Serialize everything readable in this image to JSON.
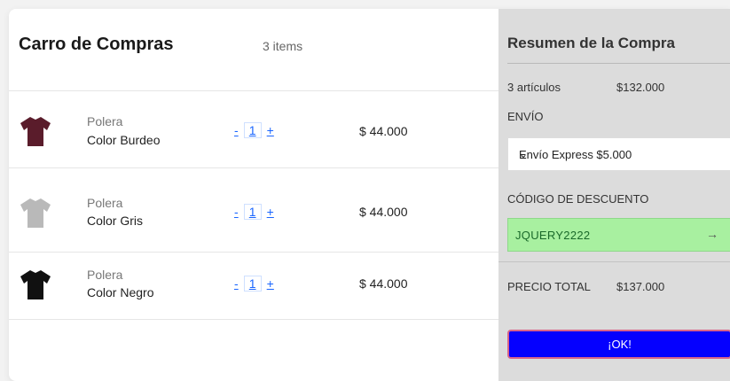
{
  "colors": {
    "ok_button": "#0500ff",
    "discount_field": "#a8f0a0",
    "quantity_link": "#1a66ff",
    "summary_bg": "#dcdcdc"
  },
  "cart": {
    "title": "Carro de Compras",
    "count": "3 items",
    "items": [
      {
        "category": "Polera",
        "name": "Color Burdeo",
        "qty": "1",
        "minus": "-",
        "plus": "+",
        "price": "$ 44.000",
        "shirt_color": "#5a1c2b",
        "icon": "tshirt-icon"
      },
      {
        "category": "Polera",
        "name": "Color Gris",
        "qty": "1",
        "minus": "-",
        "plus": "+",
        "price": "$ 44.000",
        "shirt_color": "#b9b9b9",
        "icon": "tshirt-icon"
      },
      {
        "category": "Polera",
        "name": "Color Negro",
        "qty": "1",
        "minus": "-",
        "plus": "+",
        "price": "$ 44.000",
        "shirt_color": "#111111",
        "icon": "tshirt-icon"
      }
    ]
  },
  "summary": {
    "title": "Resumen de la Compra",
    "items_label": "3 artículos",
    "items_price": "$132.000",
    "shipping_label": "ENVÍO",
    "shipping_selected": "Envío Express $5.000",
    "shipping_chevron": "⌄",
    "discount_label": "CÓDIGO DE DESCUENTO",
    "discount_value": "JQUERY2222",
    "discount_arrow": "→",
    "total_label": "PRECIO TOTAL",
    "total_value": "$137.000",
    "ok_label": "¡OK!"
  }
}
